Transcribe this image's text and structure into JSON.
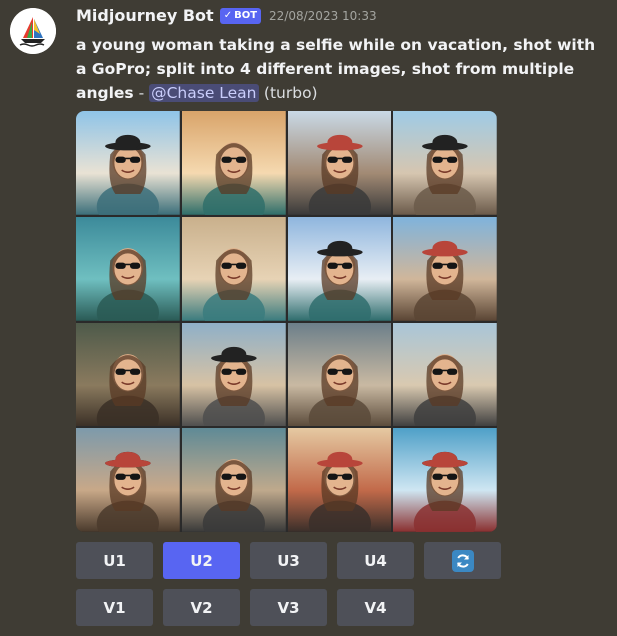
{
  "message": {
    "username": "Midjourney Bot",
    "badge": "BOT",
    "timestamp": "22/08/2023 10:33",
    "prompt": "a young woman taking a selfie while on vacation, shot with a GoPro; split into 4 different images, shot from multiple angles",
    "separator": " - ",
    "mention": "@Chase Lean",
    "mode": "(turbo)"
  },
  "upscale_buttons": [
    {
      "label": "U1",
      "active": false
    },
    {
      "label": "U2",
      "active": true
    },
    {
      "label": "U3",
      "active": false
    },
    {
      "label": "U4",
      "active": false
    }
  ],
  "variation_buttons": [
    {
      "label": "V1"
    },
    {
      "label": "V2"
    },
    {
      "label": "V3"
    },
    {
      "label": "V4"
    }
  ],
  "icons": {
    "avatar": "sailboat-logo-icon",
    "badge_check": "checkmark-icon",
    "reroll": "refresh-icon"
  },
  "colors": {
    "background": "#3f3c34",
    "accent": "#5865f2",
    "button": "#4e5058",
    "mention_bg": "#4a4c76",
    "reroll_icon": "#3b88c3"
  }
}
